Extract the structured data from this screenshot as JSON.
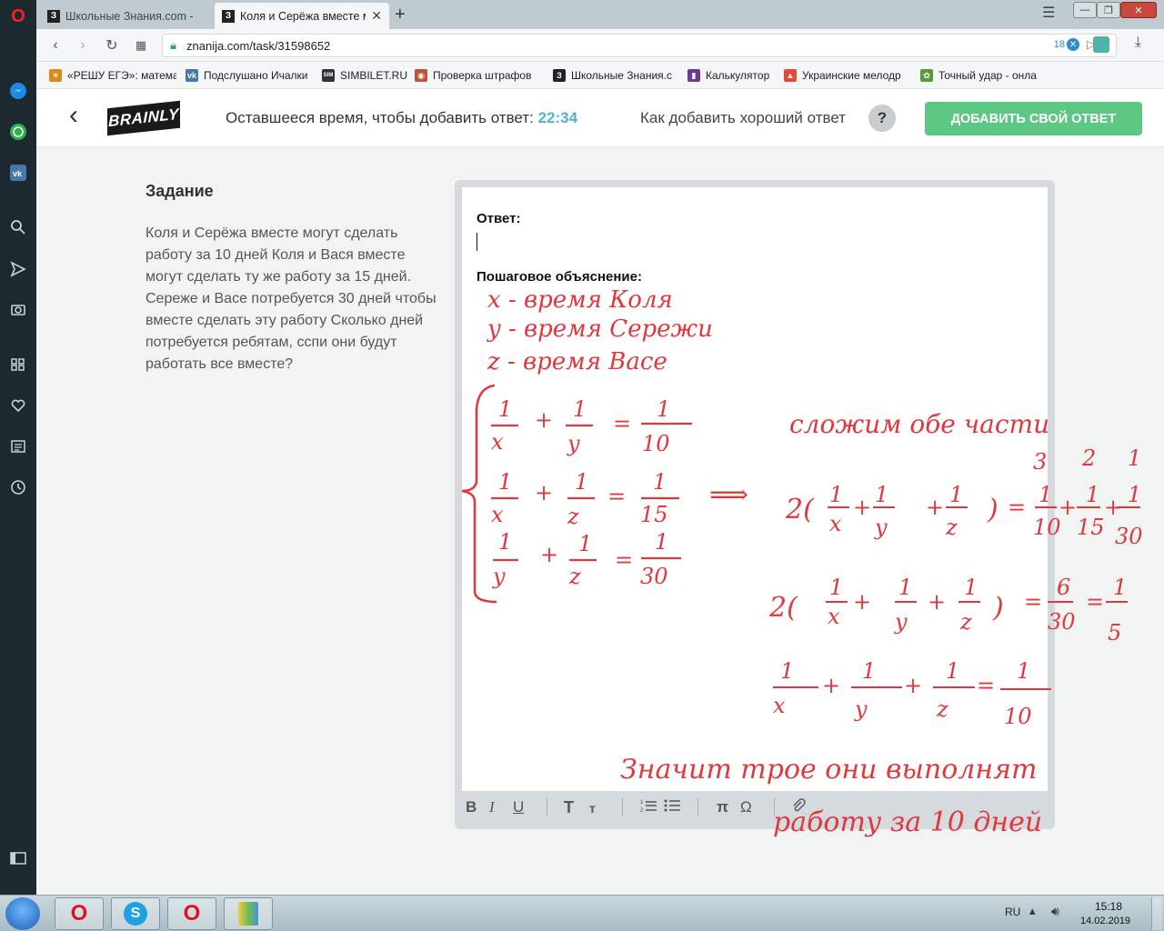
{
  "tabs": [
    {
      "title": "Школьные Знания.com - ",
      "active": false
    },
    {
      "title": "Коля и Серёжа вместе мо",
      "active": true
    }
  ],
  "address": {
    "url": "znanija.com/task/31598652",
    "badge_count": "18"
  },
  "bookmarks": [
    {
      "label": "«РЕШУ ЕГЭ»: матема",
      "color": "#d98a1e",
      "glyph": "☀"
    },
    {
      "label": "Подслушано Ичалки",
      "color": "#4a76a8",
      "glyph": "vk"
    },
    {
      "label": "SIMBILET.RU",
      "color": "#333333",
      "glyph": "SIM"
    },
    {
      "label": "Проверка штрафов",
      "color": "#b8553a",
      "glyph": "◉"
    },
    {
      "label": "Школьные Знания.c",
      "color": "#222222",
      "glyph": "З"
    },
    {
      "label": "Калькулятор",
      "color": "#6a3b8f",
      "glyph": "▮"
    },
    {
      "label": "Украинские мелодр",
      "color": "#e24a3b",
      "glyph": "▲"
    },
    {
      "label": "Точный удар - онла",
      "color": "#5a9a3a",
      "glyph": "✿"
    }
  ],
  "header": {
    "time_prefix": "Оставшееся время, чтобы добавить ответ:",
    "time_value": "22:34",
    "howto": "Как добавить хороший ответ",
    "help": "?",
    "add_answer": "ДОБАВИТЬ СВОЙ ОТВЕТ",
    "logo": "BRAINLY"
  },
  "task": {
    "title": "Задание",
    "text": "Коля и Серёжа вместе могут сделать работу за 10 дней Коля и Вася вместе могут сделать ту же работу за 15 дней. Сереже и Васе потребуется 30 дней чтобы вместе сделать эту работу Сколько дней потребуется ребятам, сспи они будут работать все вместе?"
  },
  "editor": {
    "answer_label": "Ответ:",
    "explanation_label": "Пошаговое объяснение:",
    "toolbar": {
      "bold": "B",
      "italic": "I",
      "underline": "U",
      "text_big": "T",
      "text_small": "т",
      "pi": "π",
      "omega": "Ω"
    }
  },
  "handwriting": {
    "line1": "x  - время   Коля",
    "line2": "y  - время   Сережи",
    "line3": "z  - время   Васе",
    "note_add": "сложим обе части",
    "conclusion_1": "Значит  трое  они  выполнят",
    "conclusion_2": "работу  за   10 дней"
  },
  "system": {
    "lang": "RU",
    "time": "15:18",
    "date": "14.02.2019"
  },
  "colors": {
    "accent_green": "#5cc782",
    "timer_blue": "#4fb3d9",
    "ink_red": "#e1383e",
    "sidebar": "#1c2a2f"
  }
}
